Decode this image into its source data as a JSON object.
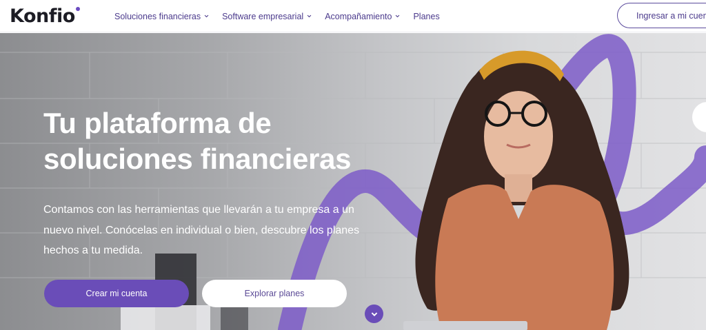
{
  "header": {
    "logo_text": "Konfio",
    "nav": [
      {
        "label": "Soluciones financieras",
        "has_dropdown": true
      },
      {
        "label": "Software empresarial",
        "has_dropdown": true
      },
      {
        "label": "Acompañamiento",
        "has_dropdown": true
      },
      {
        "label": "Planes",
        "has_dropdown": false
      }
    ],
    "login_label": "Ingresar a mi cuenta"
  },
  "hero": {
    "title": "Tu plataforma de soluciones financieras",
    "description": "Contamos con las herramientas que llevarán a tu empresa a un nuevo nivel. Conócelas en individual o bien, descubre los planes hechos a tu medida.",
    "primary_button": "Crear mi cuenta",
    "secondary_button": "Explorar planes"
  },
  "colors": {
    "brand_purple": "#6a4db8",
    "nav_text": "#4b3a8c",
    "logo_text": "#1c1c24"
  },
  "icons": {
    "nav_dropdown": "chevron-down-icon",
    "scroll": "chevron-down-icon"
  }
}
